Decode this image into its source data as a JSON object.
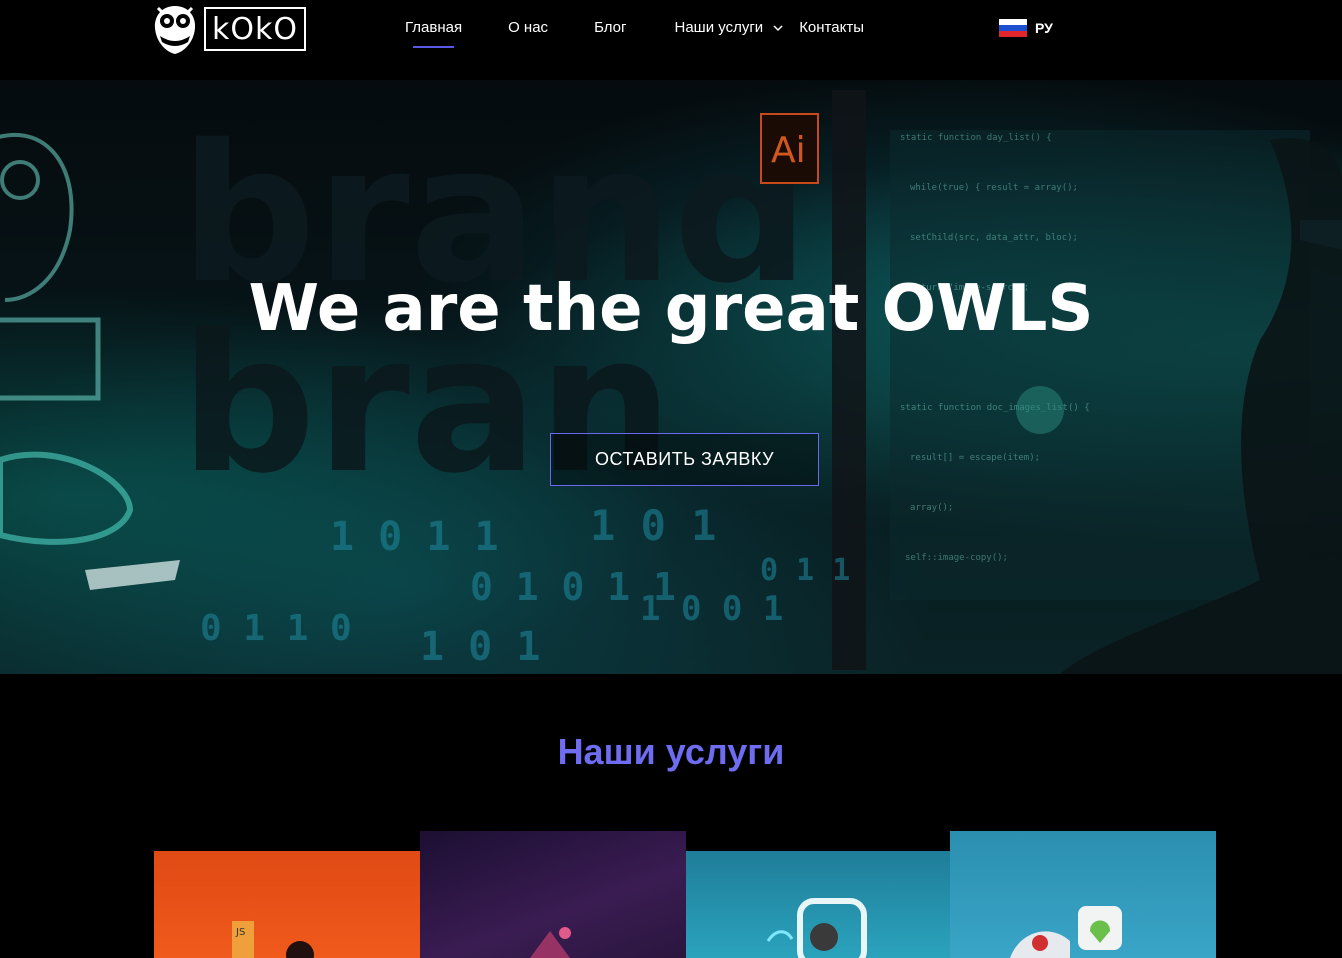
{
  "header": {
    "logo_text": "kOkO",
    "nav": [
      {
        "label": "Главная",
        "active": true
      },
      {
        "label": "О нас"
      },
      {
        "label": "Блог"
      },
      {
        "label": "Наши услуги",
        "has_dropdown": true
      },
      {
        "label": "Контакты"
      }
    ],
    "language": {
      "label": "РУ",
      "flag_colors": [
        "#ffffff",
        "#1f4fd1",
        "#e3262d"
      ]
    }
  },
  "hero": {
    "title": "We are the great OWLS",
    "cta_label": "ОСТАВИТЬ ЗАЯВКУ"
  },
  "services": {
    "title": "Наши услуги"
  },
  "colors": {
    "accent": "#6e6cf0",
    "background": "#000000"
  }
}
